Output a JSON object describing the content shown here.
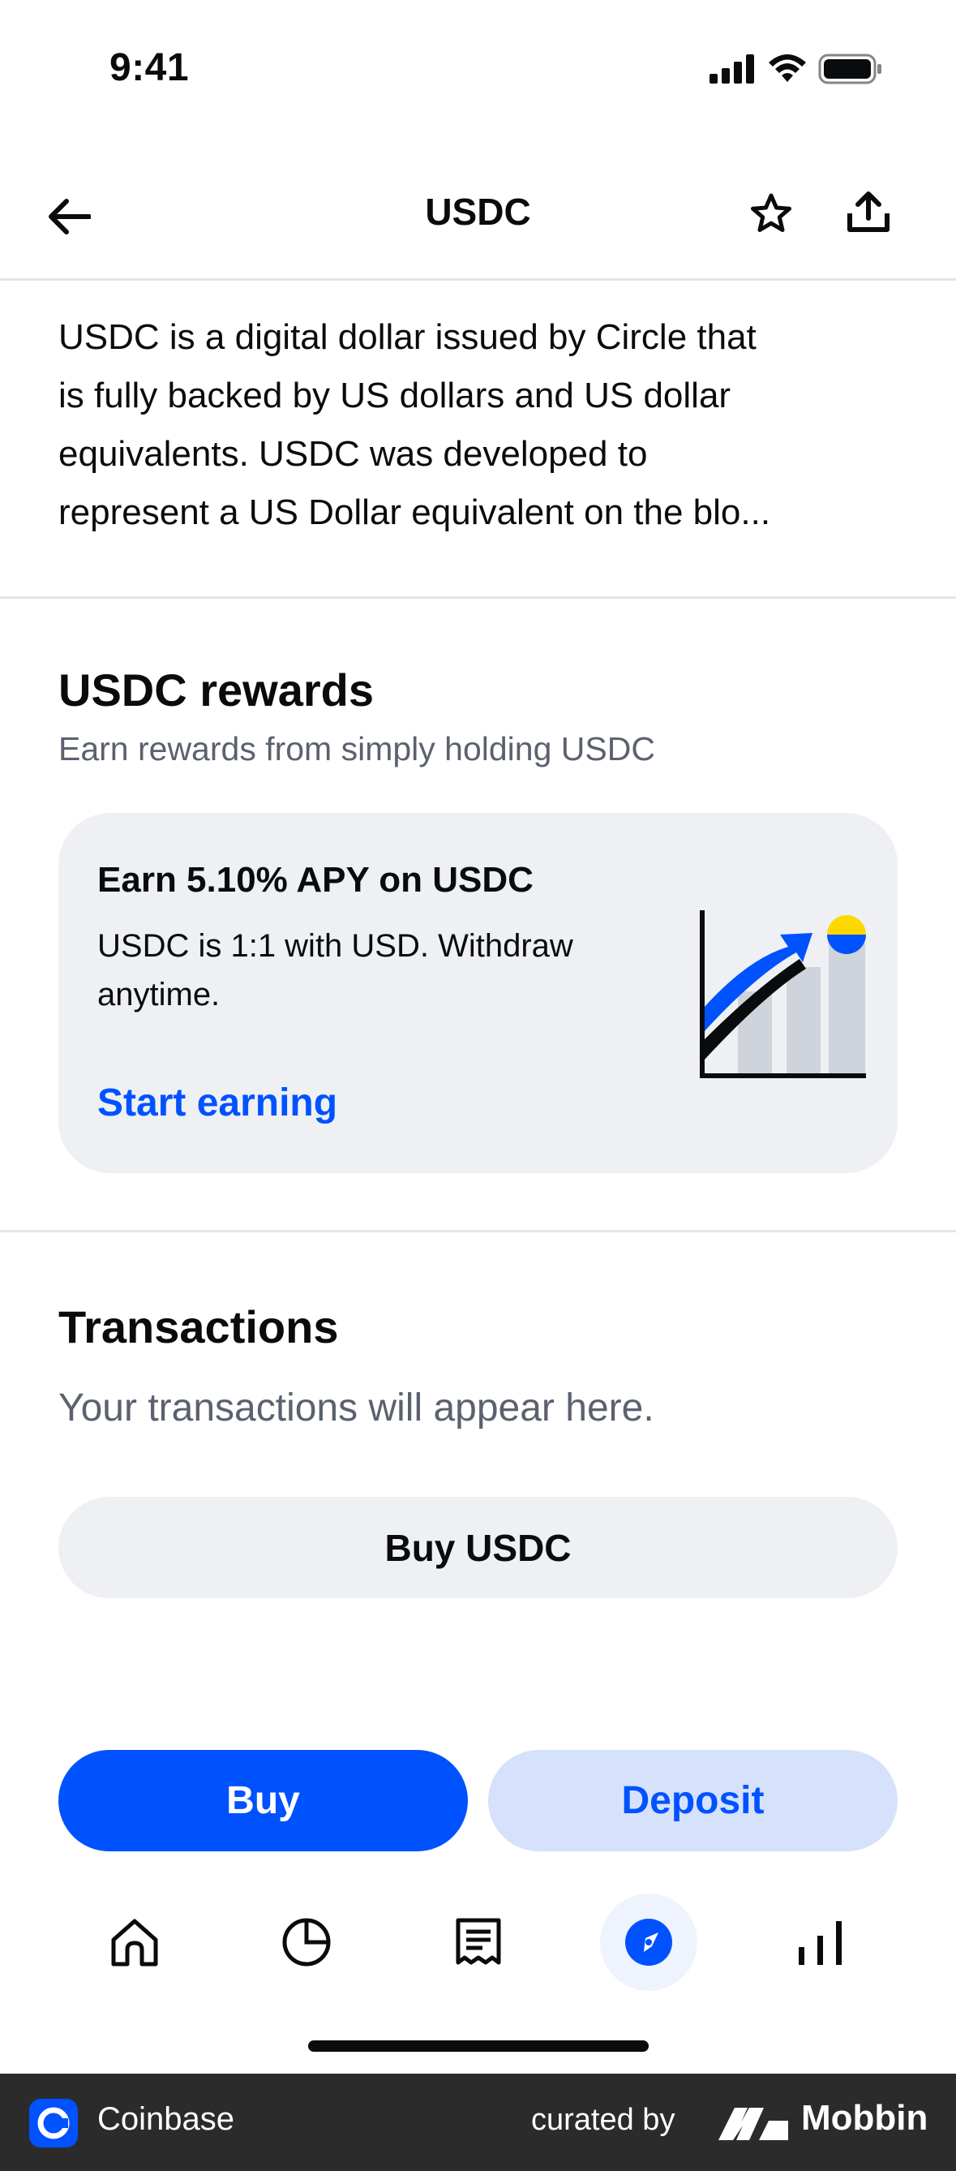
{
  "status_bar": {
    "time": "9:41"
  },
  "header": {
    "title": "USDC"
  },
  "description": {
    "lines": [
      "USDC is a digital dollar issued by Circle that",
      "is fully backed by US dollars and US dollar",
      "equivalents. USDC was developed to",
      "represent a US Dollar equivalent on the blo..."
    ]
  },
  "rewards": {
    "title": "USDC rewards",
    "subtitle": "Earn rewards from simply holding USDC",
    "card": {
      "title": "Earn 5.10% APY on USDC",
      "body": "USDC is 1:1 with USD. Withdraw anytime.",
      "link": "Start earning"
    }
  },
  "transactions": {
    "title": "Transactions",
    "empty_text": "Your transactions will appear here.",
    "buy_button": "Buy USDC"
  },
  "actions": {
    "buy": "Buy",
    "deposit": "Deposit"
  },
  "tab_bar": {
    "items": [
      {
        "icon": "home-icon"
      },
      {
        "icon": "portfolio-icon"
      },
      {
        "icon": "transactions-icon"
      },
      {
        "icon": "explore-icon",
        "active": true
      },
      {
        "icon": "markets-icon"
      }
    ]
  },
  "footer": {
    "app_name": "Coinbase",
    "curated_by": "curated by",
    "brand": "Mobbin"
  },
  "colors": {
    "accent": "#0052ff",
    "accent_light": "#d6e2fb",
    "card_bg": "#eef0f3",
    "muted_text": "#5b616e",
    "coin_yellow": "#ffd800"
  }
}
